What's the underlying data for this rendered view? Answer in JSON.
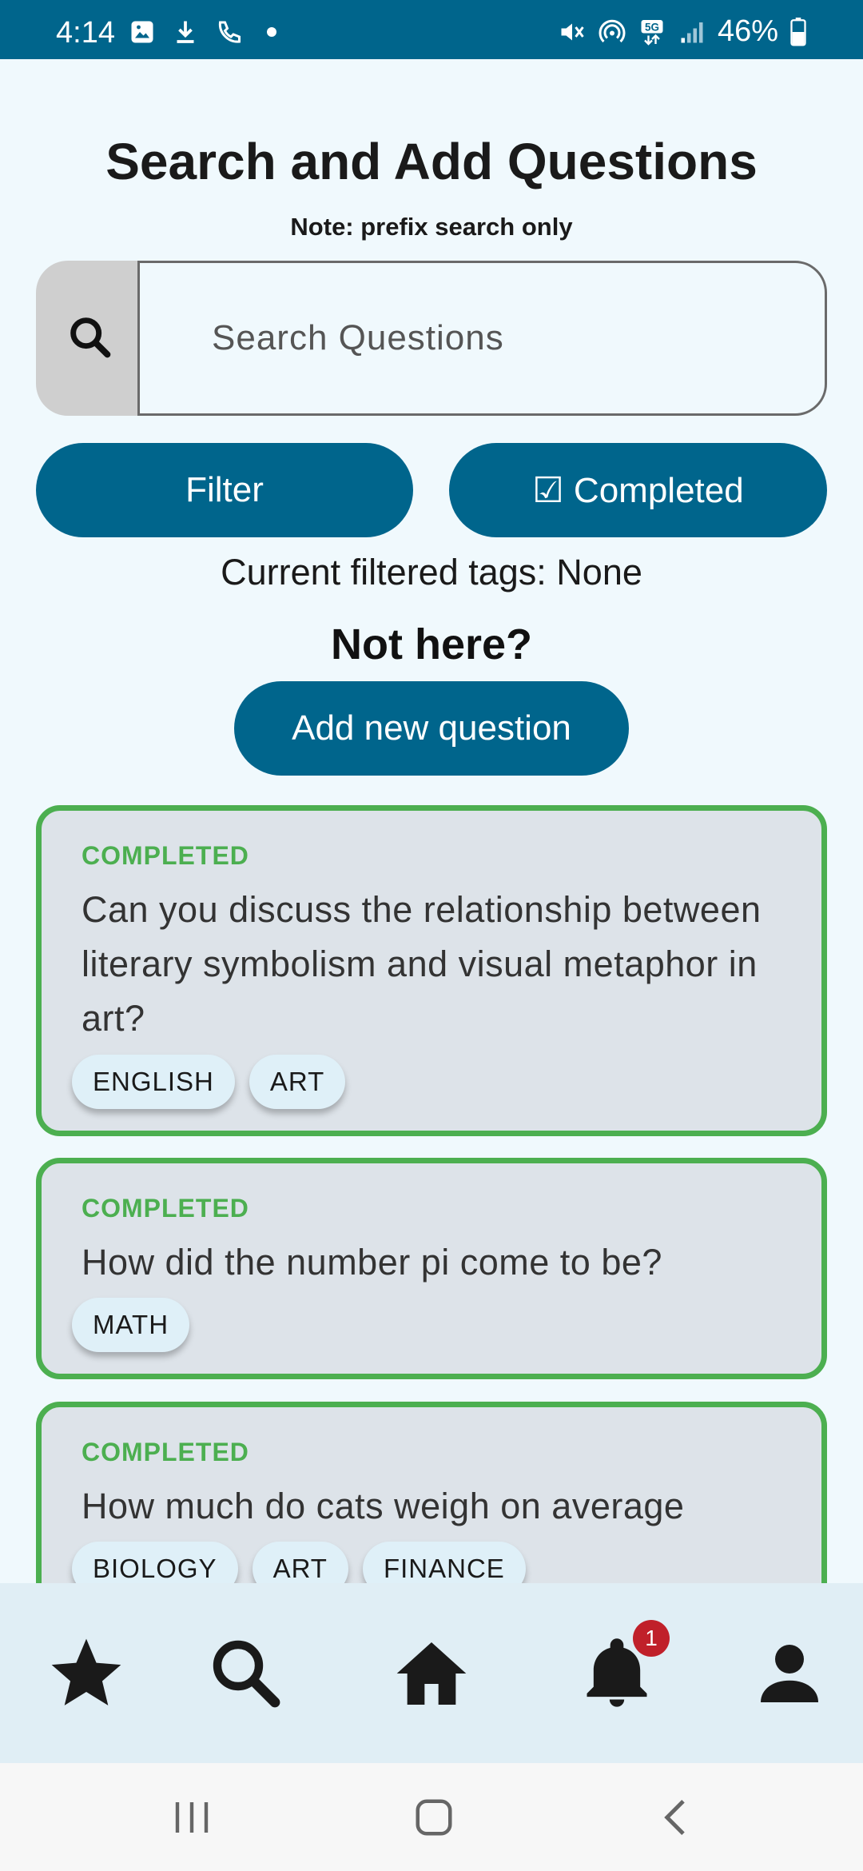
{
  "status_bar": {
    "time": "4:14",
    "battery": "46%",
    "left_icons": [
      "image-icon",
      "download-icon",
      "phone-icon",
      "dot-icon"
    ],
    "right_icons": [
      "mute-icon",
      "hotspot-icon",
      "5g-icon",
      "signal-icon",
      "battery-icon"
    ]
  },
  "header": {
    "title": "Search and Add Questions",
    "note": "Note: prefix search only"
  },
  "search": {
    "placeholder": "Search Questions",
    "value": ""
  },
  "buttons": {
    "filter_label": "Filter",
    "completed_label": "☑ Completed",
    "add_label": "Add new question"
  },
  "filtered_tags_text": "Current filtered tags: None",
  "not_here_text": "Not here?",
  "questions": [
    {
      "status": "COMPLETED",
      "text": "Can you discuss the relationship between literary symbolism and visual metaphor in art?",
      "tags": [
        "ENGLISH",
        "ART"
      ]
    },
    {
      "status": "COMPLETED",
      "text": "How did the number pi come to be?",
      "tags": [
        "MATH"
      ]
    },
    {
      "status": "COMPLETED",
      "text": "How much do cats weigh on average",
      "tags": [
        "BIOLOGY",
        "ART",
        "FINANCE"
      ]
    }
  ],
  "bottom_nav": {
    "items": [
      "star-icon",
      "search-icon",
      "home-icon",
      "bell-icon",
      "profile-icon"
    ],
    "notification_count": "1"
  },
  "colors": {
    "primary": "#00658c",
    "completed": "#4caf50",
    "background": "#f0f9fd",
    "card": "#dde3e9",
    "badge": "#c0202a"
  }
}
